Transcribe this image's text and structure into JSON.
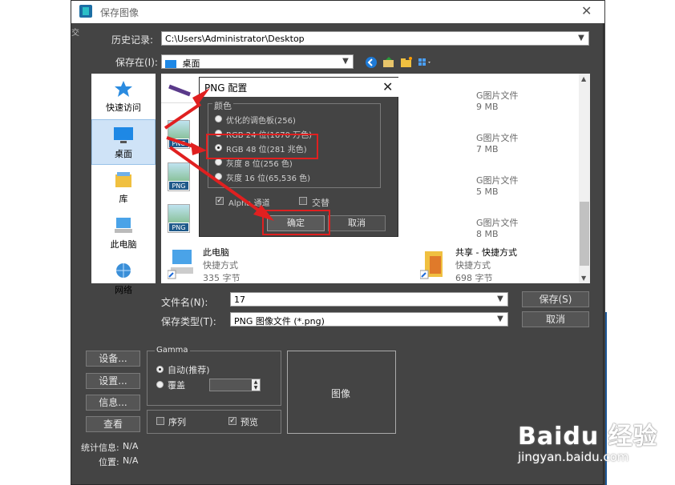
{
  "dialog": {
    "title": "保存图像",
    "edge_char": "交",
    "history_label": "历史记录:",
    "history_value": "C:\\Users\\Administrator\\Desktop",
    "savein_label": "保存在(I):",
    "savein_value": "桌面"
  },
  "places": [
    {
      "label": "快速访问",
      "icon": "star-icon"
    },
    {
      "label": "桌面",
      "icon": "desktop-icon"
    },
    {
      "label": "库",
      "icon": "library-icon"
    },
    {
      "label": "此电脑",
      "icon": "computer-icon"
    },
    {
      "label": "网络",
      "icon": "network-icon"
    }
  ],
  "files": [
    {
      "type_suffix": "G图片文件",
      "size": "9 MB"
    },
    {
      "type_suffix": "G图片文件",
      "size": "7 MB"
    },
    {
      "type_suffix": "G图片文件",
      "size": "5 MB"
    },
    {
      "type_suffix": "G图片文件",
      "size": "8 MB"
    }
  ],
  "png_tag": "PNG",
  "shortcuts": [
    {
      "name": "此电脑",
      "kind": "快捷方式",
      "size": "335 字节"
    },
    {
      "name": "共享 - 快捷方式",
      "kind": "快捷方式",
      "size": "698 字节"
    }
  ],
  "filename_label": "文件名(N):",
  "filename_value": "17",
  "filetype_label": "保存类型(T):",
  "filetype_value": "PNG 图像文件 (*.png)",
  "save_button": "保存(S)",
  "cancel_button": "取消",
  "left_buttons": [
    "设备...",
    "设置...",
    "信息...",
    "查看"
  ],
  "gamma": {
    "title": "Gamma",
    "auto": "自动(推荐)",
    "override": "覆盖"
  },
  "sequence_label": "序列",
  "preview_label": "预览",
  "image_label": "图像",
  "stats_label": "统计信息:",
  "stats_value": "N/A",
  "location_label": "位置:",
  "location_value": "N/A",
  "png_config": {
    "title": "PNG 配置",
    "group": "颜色",
    "options": [
      "优化的调色板(256)",
      "RGB 24 位(1670 万色)",
      "RGB 48 位(281 兆色)",
      "灰度 8 位(256 色)",
      "灰度 16 位(65,536 色)"
    ],
    "selected_index": 2,
    "alpha_label": "Alpha 通道",
    "interlace_label": "交替",
    "ok_button": "确定",
    "cancel_button": "取消"
  },
  "watermark": {
    "main": "Baidu 经验",
    "sub": "jingyan.baidu.com"
  }
}
